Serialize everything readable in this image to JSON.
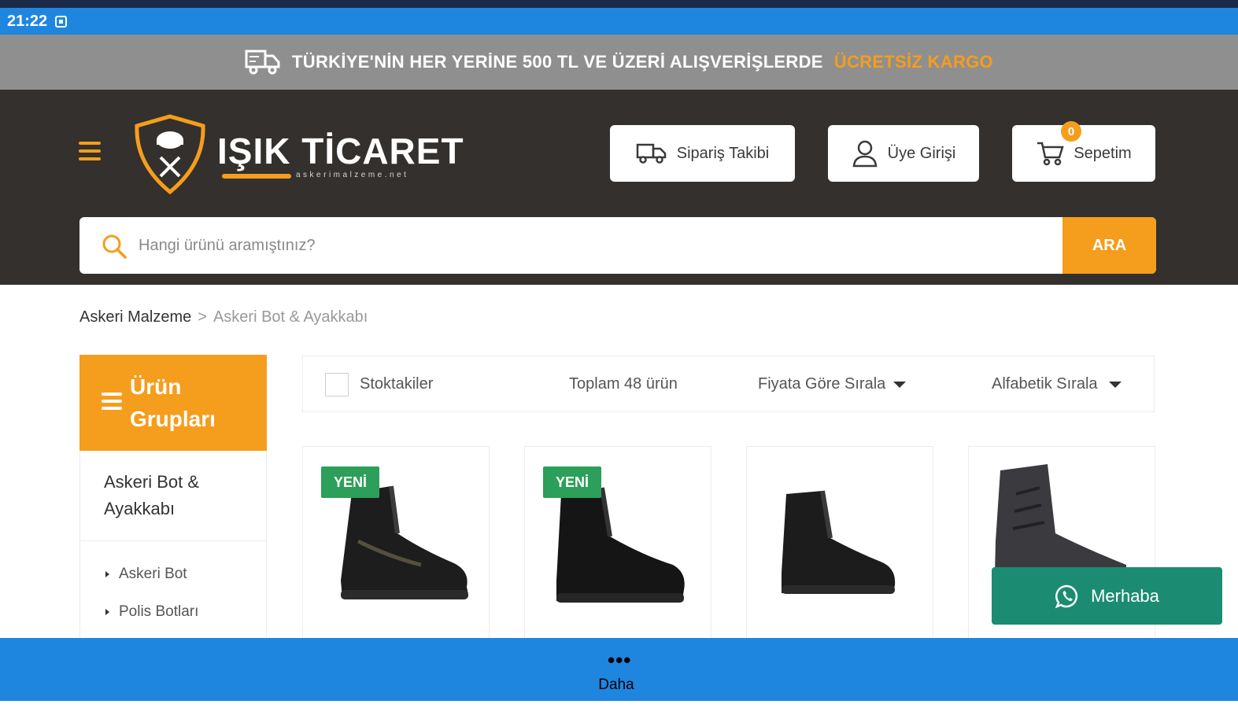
{
  "status_bar": {
    "time": "21:22"
  },
  "promo": {
    "icon": "truck-icon",
    "text": "TÜRKİYE'NİN HER YERİNE 500 TL VE ÜZERİ ALIŞVERİŞLERDE",
    "highlight": "ÜCRETSİZ KARGO",
    "highlight_color": "#f59d1c"
  },
  "header": {
    "menu_icon": "hamburger-menu-icon",
    "logo": {
      "title": "IŞIK TİCARET",
      "subtitle": "askerimalzeme.net"
    },
    "buttons": {
      "order_tracking": "Sipariş Takibi",
      "login": "Üye Girişi",
      "cart": "Sepetim"
    },
    "cart_count": "0"
  },
  "search": {
    "placeholder": "Hangi ürünü aramıştınız?",
    "button": "ARA"
  },
  "breadcrumb": {
    "root": "Askeri Malzeme",
    "separator": ">",
    "current": "Askeri Bot & Ayakkabı"
  },
  "sidebar": {
    "title": "Ürün Grupları",
    "category": "Askeri Bot & Ayakkabı",
    "items": [
      "Askeri Bot",
      "Polis Botları"
    ]
  },
  "filters": {
    "in_stock_label": "Stoktakiler",
    "total": "Toplam 48 ürün",
    "sort_price": "Fiyata Göre Sırala",
    "sort_alpha": "Alfabetik Sırala"
  },
  "products": [
    {
      "badge": "YENİ"
    },
    {
      "badge": "YENİ"
    },
    {
      "badge": ""
    },
    {
      "badge": ""
    }
  ],
  "whatsapp": {
    "label": "Merhaba",
    "icon": "whatsapp-icon"
  },
  "bottom_nav": {
    "label": "Daha",
    "icon": "more-dots-icon"
  },
  "colors": {
    "accent": "#f59d1c",
    "header_bg": "#33302d",
    "system_blue": "#1f86e0",
    "new_badge": "#2c9f5a",
    "whatsapp": "#1b8c72"
  }
}
